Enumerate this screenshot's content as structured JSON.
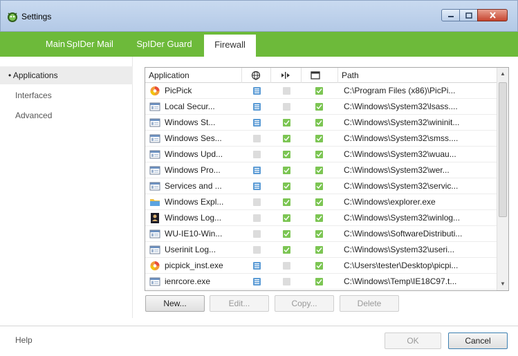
{
  "window": {
    "title": "Settings"
  },
  "tabs": [
    {
      "label": "Main"
    },
    {
      "label": "SpIDer Mail"
    },
    {
      "label": "SpIDer Guard"
    },
    {
      "label": "Firewall"
    }
  ],
  "sidebar": {
    "items": [
      {
        "label": "• Applications"
      },
      {
        "label": "Interfaces"
      },
      {
        "label": "Advanced"
      }
    ]
  },
  "table": {
    "columns": {
      "application": "Application",
      "path": "Path"
    },
    "rows": [
      {
        "app": "PicPick",
        "icon": "picpick-icon",
        "net": "blue",
        "mid": "grey",
        "win": "green",
        "path": "C:\\Program Files (x86)\\PicPi..."
      },
      {
        "app": "Local Secur...",
        "icon": "app-window-icon",
        "net": "blue",
        "mid": "grey",
        "win": "green",
        "path": "C:\\Windows\\System32\\lsass...."
      },
      {
        "app": "Windows St...",
        "icon": "app-window-icon",
        "net": "blue",
        "mid": "green",
        "win": "green",
        "path": "C:\\Windows\\System32\\wininit..."
      },
      {
        "app": "Windows Ses...",
        "icon": "app-window-icon",
        "net": "grey",
        "mid": "green",
        "win": "green",
        "path": "C:\\Windows\\System32\\smss...."
      },
      {
        "app": "Windows Upd...",
        "icon": "app-window-icon",
        "net": "grey",
        "mid": "green",
        "win": "green",
        "path": "C:\\Windows\\System32\\wuau..."
      },
      {
        "app": "Windows Pro...",
        "icon": "app-window-icon",
        "net": "blue",
        "mid": "green",
        "win": "green",
        "path": "C:\\Windows\\System32\\wer..."
      },
      {
        "app": "Services and ...",
        "icon": "app-window-icon",
        "net": "blue",
        "mid": "green",
        "win": "green",
        "path": "C:\\Windows\\System32\\servic..."
      },
      {
        "app": "Windows Expl...",
        "icon": "explorer-folder-icon",
        "net": "grey",
        "mid": "green",
        "win": "green",
        "path": "C:\\Windows\\explorer.exe"
      },
      {
        "app": "Windows Log...",
        "icon": "logon-icon",
        "net": "grey",
        "mid": "green",
        "win": "green",
        "path": "C:\\Windows\\System32\\winlog..."
      },
      {
        "app": "WU-IE10-Win...",
        "icon": "app-window-icon",
        "net": "grey",
        "mid": "green",
        "win": "green",
        "path": "C:\\Windows\\SoftwareDistributi..."
      },
      {
        "app": "Userinit Log...",
        "icon": "app-window-icon",
        "net": "grey",
        "mid": "green",
        "win": "green",
        "path": "C:\\Windows\\System32\\useri..."
      },
      {
        "app": "picpick_inst.exe",
        "icon": "picpick-icon",
        "net": "blue",
        "mid": "grey",
        "win": "green",
        "path": "C:\\Users\\tester\\Desktop\\picpi..."
      },
      {
        "app": "ienrcore.exe",
        "icon": "app-window-icon",
        "net": "blue",
        "mid": "grey",
        "win": "green",
        "path": "C:\\Windows\\Temp\\IE18C97.t..."
      }
    ]
  },
  "buttons": {
    "new": "New...",
    "edit": "Edit...",
    "copy": "Copy...",
    "delete": "Delete"
  },
  "footer": {
    "help": "Help",
    "ok": "OK",
    "cancel": "Cancel"
  },
  "colors": {
    "tabbar": "#6dba3a",
    "check_blue": "#5b9bd5",
    "check_green": "#7cc553",
    "check_grey": "#dcdcdc"
  }
}
